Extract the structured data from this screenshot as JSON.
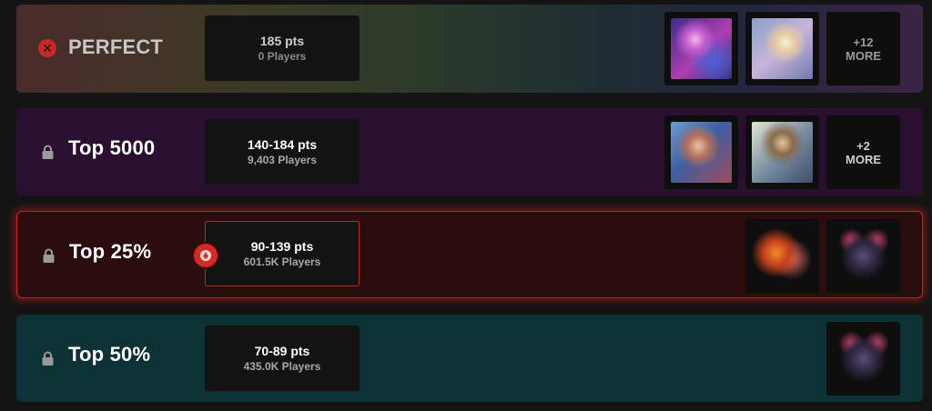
{
  "tiers": [
    {
      "name": "PERFECT",
      "status_icon": "x-circle-icon",
      "pts": "185 pts",
      "players": "0 Players",
      "more": [
        "+12",
        "MORE"
      ],
      "rewards": [
        "reward-skin-art",
        "reward-skin-art"
      ]
    },
    {
      "name": "Top 5000",
      "status_icon": "lock-icon",
      "pts": "140-184 pts",
      "players": "9,403 Players",
      "more": [
        "+2",
        "MORE"
      ],
      "rewards": [
        "reward-skin-art",
        "reward-skin-art"
      ]
    },
    {
      "name": "Top 25%",
      "status_icon": "lock-icon",
      "pts": "90-139 pts",
      "players": "601.5K Players",
      "current_tier": true,
      "marker_icon": "rank-marker-icon",
      "rewards": [
        "reward-icon-art",
        "reward-icon-art"
      ]
    },
    {
      "name": "Top 50%",
      "status_icon": "lock-icon",
      "pts": "70-89 pts",
      "players": "435.0K Players",
      "rewards": [
        "reward-icon-art"
      ]
    }
  ],
  "colors": {
    "current_tier_border": "#c7221f",
    "perfect_status": "#c62828",
    "top5000_bg": "#2b0f31",
    "top25_bg": "#2c0d0d",
    "top50_bg": "#0c3236"
  }
}
